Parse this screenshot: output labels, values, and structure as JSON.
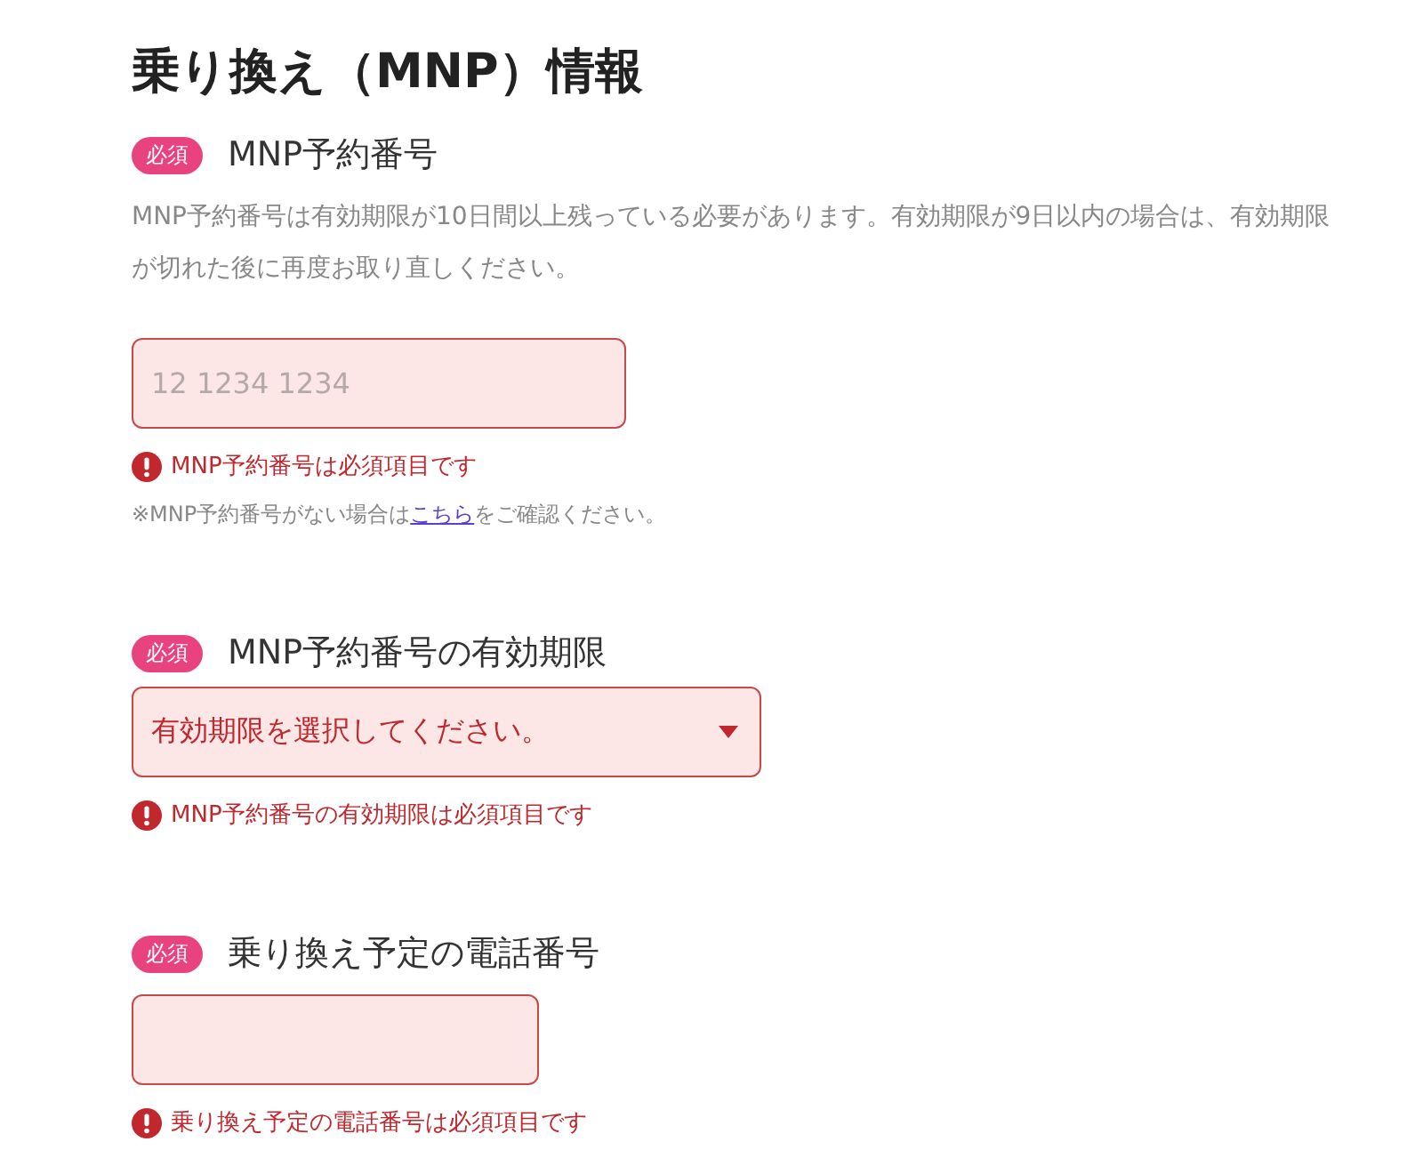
{
  "title": "乗り換え（MNP）情報",
  "fields": [
    {
      "kind": "text",
      "required": true,
      "badge": "必須",
      "label": "MNP予約番号",
      "description": "MNP予約番号は有効期限が10日間以上残っている必要があります。有効期限が9日以内の場合は、有効期限が切れた後に再度お取り直しください。",
      "placeholder": "12 1234 1234",
      "invalid": true,
      "error": "MNP予約番号は必須項目です",
      "note": {
        "before": "※MNP予約番号がない場合は",
        "link": "こちら",
        "after": "をご確認ください。"
      }
    },
    {
      "kind": "select",
      "required": true,
      "badge": "必須",
      "label": "MNP予約番号の有効期限",
      "value": "有効期限を選択してください。",
      "invalid": true,
      "error": "MNP予約番号の有効期限は必須項目です"
    },
    {
      "kind": "text",
      "required": true,
      "badge": "必須",
      "label": "乗り換え予定の電話番号",
      "invalid": true,
      "error": "乗り換え予定の電話番号は必須項目です"
    }
  ]
}
